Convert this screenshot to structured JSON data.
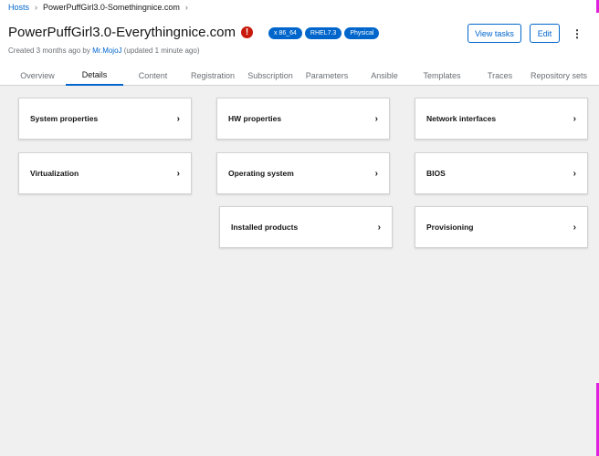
{
  "breadcrumb": {
    "root": "Hosts",
    "current": "PowerPuffGirl3.0-Somethingnice.com"
  },
  "host": {
    "name": "PowerPuffGirl3.0-Everythingnice.com",
    "status_icon": "exclamation-circle-icon",
    "status_color": "#c9190b",
    "labels": [
      "x 86_64",
      "RHEL7.3",
      "Physical"
    ],
    "meta_prefix": "Created 3 months ago by",
    "meta_user": "Mr.MojoJ",
    "meta_suffix": "(updated 1 minute ago)"
  },
  "actions": {
    "view_tasks": "View tasks",
    "edit": "Edit",
    "kebab": "⋮"
  },
  "tabs": [
    "Overview",
    "Details",
    "Content",
    "Registration",
    "Subscription",
    "Parameters",
    "Ansible",
    "Templates",
    "Traces",
    "Repository sets"
  ],
  "active_tab": "Details",
  "cards": [
    "System properties",
    "HW properties",
    "Network interfaces",
    "Virtualization",
    "Operating system",
    "BIOS",
    "Installed products",
    "Provisioning"
  ],
  "chevron": "›",
  "accent": "#0066cc"
}
